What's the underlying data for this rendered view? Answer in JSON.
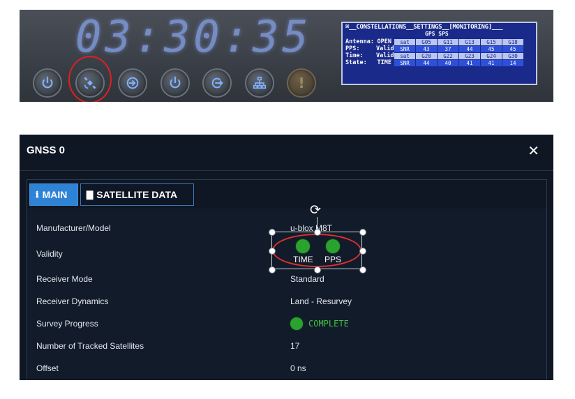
{
  "device": {
    "clock": "03:30:35",
    "buttons": [
      {
        "icon": "power-icon"
      },
      {
        "icon": "satellite-icon"
      },
      {
        "icon": "login-icon"
      },
      {
        "icon": "power-icon"
      },
      {
        "icon": "logout-icon"
      },
      {
        "icon": "network-icon"
      },
      {
        "icon": "warning-icon",
        "label": "!"
      }
    ],
    "lcd": {
      "header": "⌘__CONSTELLATIONS__SETTINGS__[MONITORING]___",
      "subheader": "GPS SPS",
      "status": [
        {
          "label": "Antenna:",
          "value": "OPEN"
        },
        {
          "label": "PPS:",
          "value": "Valid"
        },
        {
          "label": "Time:",
          "value": "Valid"
        },
        {
          "label": "State:",
          "value": "TIME"
        }
      ],
      "table": [
        [
          "sat",
          "G05",
          "G11",
          "G13",
          "G15",
          "G18"
        ],
        [
          "SNR",
          "43",
          "37",
          "44",
          "45",
          "45"
        ],
        [
          "sat",
          "G20",
          "G22",
          "G23",
          "G24",
          "G30"
        ],
        [
          "SNR",
          "44",
          "40",
          "41",
          "41",
          "14"
        ]
      ]
    }
  },
  "panel": {
    "title": "GNSS 0",
    "close": "✕",
    "tabs": [
      {
        "icon": "info-icon",
        "glyph": "ℹ",
        "label": "MAIN",
        "active": true
      },
      {
        "icon": "chart-icon",
        "glyph": "▇",
        "label": "SATELLITE DATA",
        "active": false
      }
    ],
    "rows": [
      {
        "label": "Manufacturer/Model",
        "value": "u-blox M8T"
      },
      {
        "label": "Validity",
        "value": ""
      },
      {
        "label": "Receiver Mode",
        "value": "Standard"
      },
      {
        "label": "Receiver Dynamics",
        "value": "Land - Resurvey"
      },
      {
        "label": "Survey Progress",
        "value": ""
      },
      {
        "label": "Number of Tracked Satellites",
        "value": "17"
      },
      {
        "label": "Offset",
        "value": "0 ns"
      }
    ],
    "validity": [
      {
        "label": "TIME",
        "color": "#2aa32e"
      },
      {
        "label": "PPS",
        "color": "#2aa32e"
      }
    ],
    "survey_status": "COMPLETE",
    "colors": {
      "accent": "#2f83d6",
      "ok": "#2aa32e",
      "annotation": "#e03030",
      "background": "#0f1724"
    }
  }
}
